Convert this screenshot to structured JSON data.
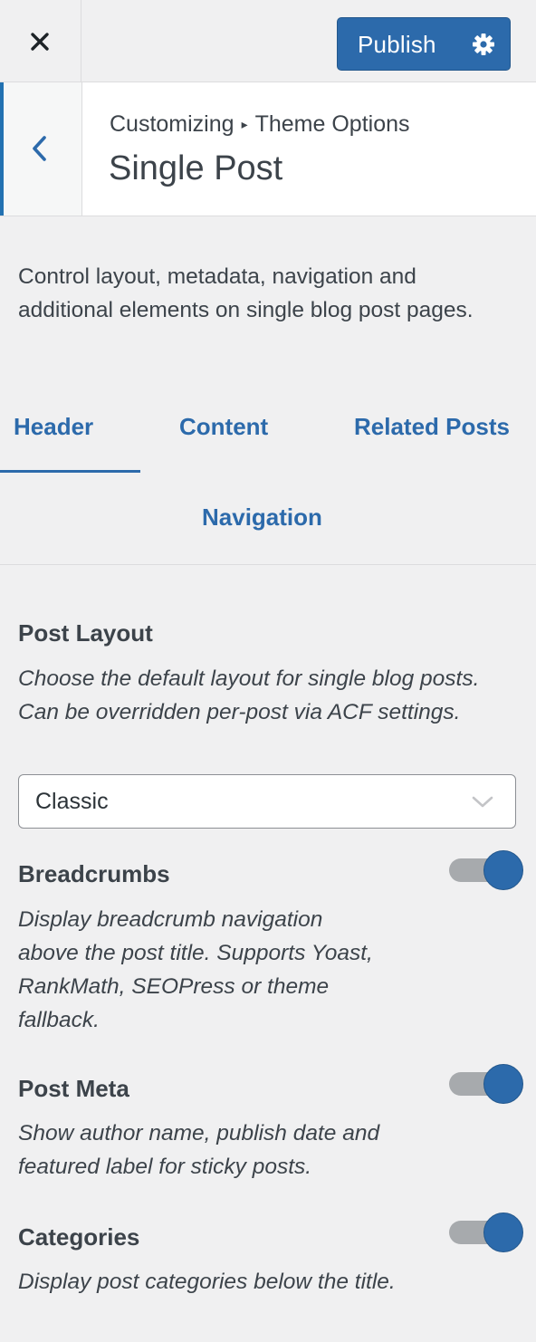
{
  "topbar": {
    "close_icon": "close-icon",
    "publish_label": "Publish",
    "settings_icon": "gear-icon"
  },
  "section": {
    "breadcrumb_parent": "Customizing",
    "breadcrumb_separator": "▸",
    "breadcrumb_current": "Theme Options",
    "title": "Single Post",
    "back_icon": "chevron-left-icon"
  },
  "description": "Control layout, metadata, navigation and additional elements on single blog post pages.",
  "tabs": [
    {
      "label": "Header",
      "active": true
    },
    {
      "label": "Content",
      "active": false
    },
    {
      "label": "Related Posts",
      "active": false
    },
    {
      "label": "Navigation",
      "active": false
    }
  ],
  "controls": {
    "post_layout": {
      "title": "Post Layout",
      "description": "Choose the default layout for single blog posts. Can be overridden per-post via ACF settings.",
      "selected": "Classic"
    },
    "breadcrumbs": {
      "title": "Breadcrumbs",
      "description": "Display breadcrumb navigation above the post title. Supports Yoast, RankMath, SEOPress or theme fallback.",
      "enabled": true
    },
    "post_meta": {
      "title": "Post Meta",
      "description": "Show author name, publish date and featured label for sticky posts.",
      "enabled": true
    },
    "categories": {
      "title": "Categories",
      "description": "Display post categories below the title.",
      "enabled": true
    }
  },
  "colors": {
    "accent": "#2c6aab",
    "panel_bg": "#f0f0f1",
    "text": "#3c434a",
    "toggle_track": "#a7aaad"
  }
}
